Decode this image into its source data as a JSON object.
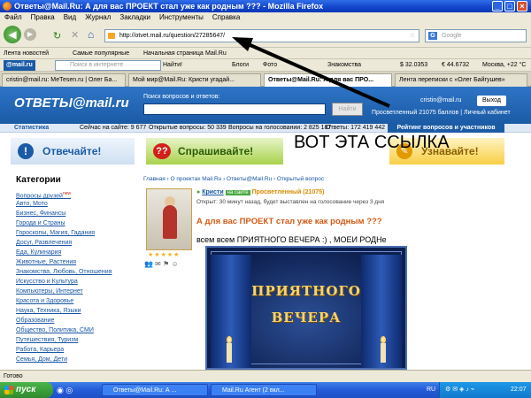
{
  "window": {
    "title": "Ответы@Mail.Ru: А для вас ПРОЕКТ стал уже как родным ??? - Mozilla Firefox"
  },
  "menu": [
    "Файл",
    "Правка",
    "Вид",
    "Журнал",
    "Закладки",
    "Инструменты",
    "Справка"
  ],
  "address": {
    "url": "http://otvet.mail.ru/question/27285647/",
    "search_placeholder": "Google"
  },
  "bookmarks": [
    "Лента новостей",
    "Самые популярные",
    "Начальная страница",
    "Mail.Ru"
  ],
  "mail_toolbar": {
    "logo": "@mail.ru",
    "search_placeholder": "Поиск в интернете",
    "find": "Найти!",
    "items": [
      "Блоги",
      "Фото",
      "Знакомства",
      "$ 32.0353",
      "€ 44.6732",
      "Москва, +22 °C"
    ]
  },
  "tabs": [
    "cristin@mail.ru: МеТеsen.ru | Олег Ба...",
    "Мой мир@Mail.Ru: Кристи угадай...",
    "Ответы@Mail.Ru: А для вас ПРО...",
    "Лента переписки с «Олег Байгушев»"
  ],
  "site": {
    "logo": "ОТВЕТЫ@mail.ru",
    "search_label": "Поиск вопросов и ответов:",
    "search_button": "Найти",
    "user_email": "cristin@mail.ru",
    "exit": "Выход",
    "user_status": "Просветленный 21075 баллов | Личный кабинет"
  },
  "stats": {
    "label": "Статистика",
    "online": "Сейчас на сайте: 9 677",
    "open": "Открытые вопросы: 50 339",
    "voting": "Вопросы на голосовании: 2 825 187",
    "answers": "Ответы: 172 419 442",
    "rating": "Рейтинг вопросов и участников"
  },
  "actions": {
    "answer": "Отвечайте!",
    "ask": "Спрашивайте!",
    "learn": "Узнавайте!"
  },
  "callout": "ВОТ ЭТА ССЫЛКА",
  "sidebar": {
    "title": "Категории",
    "items": [
      "Вопросы друзей",
      "Авто, Мото",
      "Бизнес, Финансы",
      "Города и Страны",
      "Гороскопы, Магия, Гадания",
      "Досуг, Развлечения",
      "Еда, Кулинария",
      "Животные, Растения",
      "Знакомства, Любовь, Отношения",
      "Искусство и Культура",
      "Компьютеры, Интернет",
      "Красота и Здоровье",
      "Наука, Техника, Языки",
      "Образование",
      "Общество, Политика, СМИ",
      "Путешествия, Туризм",
      "Работа, Карьера",
      "Семья, Дом, Дети"
    ],
    "new_badge": "new"
  },
  "breadcrumb": "Главная › О проектах Mail.Ru › Ответы@Mail.Ru › Открытый вопрос",
  "question": {
    "author": "Кристи",
    "online_badge": "на сайте",
    "rank": "Просветленный (21075)",
    "meta": "Открыт: 30 минут назад, будет выставлен на голосование через 3 дня",
    "title": "А для вас ПРОЕКТ стал уже как родным ???",
    "text": "всем всем ПРИЯТНОГО ВЕЧЕРА :) , МОЕИ РОДНе",
    "image_line1": "ПРИЯТНОГО",
    "image_line2": "ВЕЧЕРА"
  },
  "status": "Готово",
  "taskbar": {
    "start": "пуск",
    "items": [
      "Ответы@Mail.Ru: А ...",
      "Mail.Ru Агент (2 вкл..."
    ],
    "lang": "RU",
    "time": "22:07"
  }
}
